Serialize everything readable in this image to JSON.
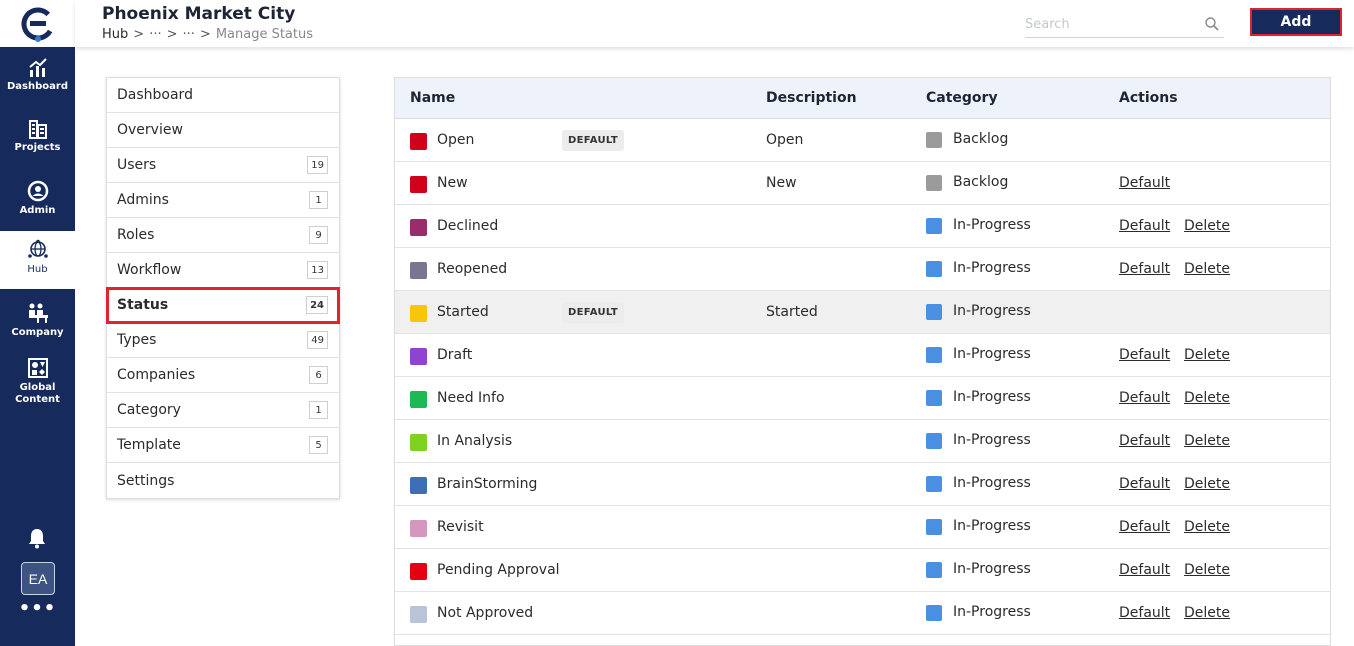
{
  "rail": {
    "items": [
      {
        "label": "Dashboard",
        "icon": "dashboard-chart-icon"
      },
      {
        "label": "Projects",
        "icon": "projects-building-icon"
      },
      {
        "label": "Admin",
        "icon": "admin-user-icon"
      },
      {
        "label": "Hub",
        "icon": "hub-globe-icon"
      },
      {
        "label": "Company",
        "icon": "company-people-icon"
      },
      {
        "label": "Global Content",
        "icon": "global-content-icon"
      }
    ],
    "active": "Hub",
    "avatar": "EA",
    "more": "•••"
  },
  "header": {
    "title": "Phoenix Market City",
    "breadcrumb": [
      "Hub",
      ">",
      "···",
      ">",
      "···",
      ">",
      "Manage Status"
    ],
    "search_placeholder": "Search",
    "search_value": "",
    "add_label": "Add"
  },
  "side_menu": {
    "items": [
      {
        "label": "Dashboard",
        "count": ""
      },
      {
        "label": "Overview",
        "count": ""
      },
      {
        "label": "Users",
        "count": "19"
      },
      {
        "label": "Admins",
        "count": "1"
      },
      {
        "label": "Roles",
        "count": "9"
      },
      {
        "label": "Workflow",
        "count": "13"
      },
      {
        "label": "Status",
        "count": "24"
      },
      {
        "label": "Types",
        "count": "49"
      },
      {
        "label": "Companies",
        "count": "6"
      },
      {
        "label": "Category",
        "count": "1"
      },
      {
        "label": "Template",
        "count": "5"
      },
      {
        "label": "Settings",
        "count": ""
      }
    ],
    "selected": "Status"
  },
  "table": {
    "columns": [
      "Name",
      "Description",
      "Category",
      "Actions"
    ],
    "rows": [
      {
        "name": "Open",
        "color": "#d0021b",
        "badge": "DEFAULT",
        "description": "Open",
        "category": "Backlog",
        "category_color": "#9b9b9b",
        "actions": []
      },
      {
        "name": "New",
        "color": "#d0021b",
        "badge": "",
        "description": "New",
        "category": "Backlog",
        "category_color": "#9b9b9b",
        "actions": [
          "Default"
        ]
      },
      {
        "name": "Declined",
        "color": "#9b2c6b",
        "badge": "",
        "description": "",
        "category": "In-Progress",
        "category_color": "#4a90e2",
        "actions": [
          "Default",
          "Delete"
        ]
      },
      {
        "name": "Reopened",
        "color": "#7a7591",
        "badge": "",
        "description": "",
        "category": "In-Progress",
        "category_color": "#4a90e2",
        "actions": [
          "Default",
          "Delete"
        ]
      },
      {
        "name": "Started",
        "color": "#f8c507",
        "badge": "DEFAULT",
        "description": "Started",
        "category": "In-Progress",
        "category_color": "#4a90e2",
        "actions": [],
        "highlight": true
      },
      {
        "name": "Draft",
        "color": "#8e44d1",
        "badge": "",
        "description": "",
        "category": "In-Progress",
        "category_color": "#4a90e2",
        "actions": [
          "Default",
          "Delete"
        ]
      },
      {
        "name": "Need Info",
        "color": "#1db954",
        "badge": "",
        "description": "",
        "category": "In-Progress",
        "category_color": "#4a90e2",
        "actions": [
          "Default",
          "Delete"
        ]
      },
      {
        "name": "In Analysis",
        "color": "#7ed321",
        "badge": "",
        "description": "",
        "category": "In-Progress",
        "category_color": "#4a90e2",
        "actions": [
          "Default",
          "Delete"
        ]
      },
      {
        "name": "BrainStorming",
        "color": "#3e6eb5",
        "badge": "",
        "description": "",
        "category": "In-Progress",
        "category_color": "#4a90e2",
        "actions": [
          "Default",
          "Delete"
        ]
      },
      {
        "name": "Revisit",
        "color": "#d597bd",
        "badge": "",
        "description": "",
        "category": "In-Progress",
        "category_color": "#4a90e2",
        "actions": [
          "Default",
          "Delete"
        ]
      },
      {
        "name": "Pending Approval",
        "color": "#e60012",
        "badge": "",
        "description": "",
        "category": "In-Progress",
        "category_color": "#4a90e2",
        "actions": [
          "Default",
          "Delete"
        ]
      },
      {
        "name": "Not Approved",
        "color": "#b8c4d8",
        "badge": "",
        "description": "",
        "category": "In-Progress",
        "category_color": "#4a90e2",
        "actions": [
          "Default",
          "Delete"
        ]
      }
    ]
  }
}
